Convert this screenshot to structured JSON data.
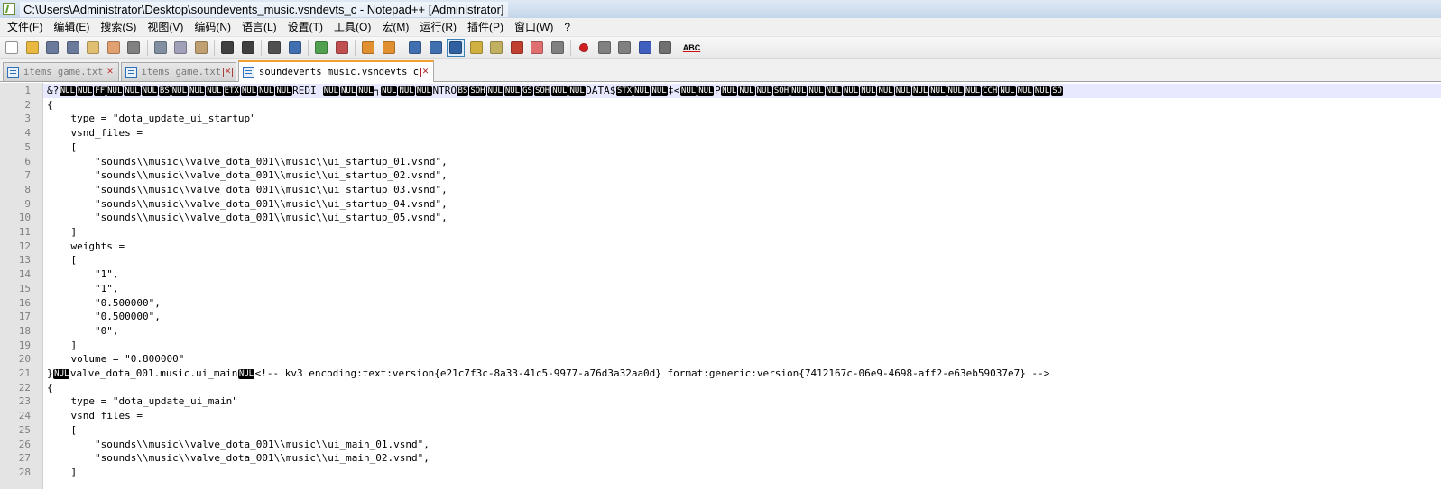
{
  "window": {
    "title": "C:\\Users\\Administrator\\Desktop\\soundevents_music.vsndevts_c - Notepad++ [Administrator]"
  },
  "menu": [
    "文件(F)",
    "编辑(E)",
    "搜索(S)",
    "视图(V)",
    "编码(N)",
    "语言(L)",
    "设置(T)",
    "工具(O)",
    "宏(M)",
    "运行(R)",
    "插件(P)",
    "窗口(W)",
    "?"
  ],
  "toolbar": {
    "spellcheck_label": "ABC",
    "buttons": [
      {
        "name": "new-file-icon",
        "color": "#ffffff"
      },
      {
        "name": "open-file-icon",
        "color": "#e8b840"
      },
      {
        "name": "save-icon",
        "color": "#6a7a9a"
      },
      {
        "name": "save-all-icon",
        "color": "#6a7a9a"
      },
      {
        "name": "close-icon",
        "color": "#e0c070"
      },
      {
        "name": "close-all-icon",
        "color": "#e0a070"
      },
      {
        "name": "print-icon",
        "color": "#808080"
      },
      {
        "name": "cut-icon",
        "color": "#8090a0"
      },
      {
        "name": "copy-icon",
        "color": "#a0a0b8"
      },
      {
        "name": "paste-icon",
        "color": "#c0a070"
      },
      {
        "name": "undo-icon",
        "color": "#404040"
      },
      {
        "name": "redo-icon",
        "color": "#404040"
      },
      {
        "name": "find-icon",
        "color": "#505050"
      },
      {
        "name": "replace-icon",
        "color": "#4070b0"
      },
      {
        "name": "zoom-in-icon",
        "color": "#50a050"
      },
      {
        "name": "zoom-out-icon",
        "color": "#c05050"
      },
      {
        "name": "sync-vertical-icon",
        "color": "#e09030"
      },
      {
        "name": "sync-horizontal-icon",
        "color": "#e09030"
      },
      {
        "name": "word-wrap-icon",
        "color": "#4070b0"
      },
      {
        "name": "show-all-chars-icon",
        "color": "#4070b0"
      },
      {
        "name": "indent-guide-icon",
        "color": "#3060a0"
      },
      {
        "name": "doc-map-icon",
        "color": "#d0b040"
      },
      {
        "name": "folder-workspace-icon",
        "color": "#c0b060"
      },
      {
        "name": "function-list-icon",
        "color": "#c04030"
      },
      {
        "name": "folder-as-workspace-icon",
        "color": "#e07070"
      },
      {
        "name": "monitoring-icon",
        "color": "#808080"
      },
      {
        "name": "record-macro-icon",
        "color": "#d02020"
      },
      {
        "name": "stop-macro-icon",
        "color": "#808080"
      },
      {
        "name": "play-macro-icon",
        "color": "#808080"
      },
      {
        "name": "run-macro-multiple-icon",
        "color": "#4060c0"
      },
      {
        "name": "save-macro-icon",
        "color": "#707070"
      }
    ]
  },
  "tabs": [
    {
      "label": "items_game.txt",
      "active": false
    },
    {
      "label": "items_game.txt",
      "active": false
    },
    {
      "label": "soundevents_music.vsndevts_c",
      "active": true
    }
  ],
  "editor": {
    "lines": [
      {
        "n": "1",
        "segs": [
          [
            "t",
            "&?"
          ],
          [
            "c",
            "NUL"
          ],
          [
            "c",
            "NUL"
          ],
          [
            "c",
            "FF"
          ],
          [
            "c",
            "NUL"
          ],
          [
            "c",
            "NUL"
          ],
          [
            "c",
            "NUL"
          ],
          [
            "c",
            "BS"
          ],
          [
            "c",
            "NUL"
          ],
          [
            "c",
            "NUL"
          ],
          [
            "c",
            "NUL"
          ],
          [
            "c",
            "ETX"
          ],
          [
            "c",
            "NUL"
          ],
          [
            "c",
            "NUL"
          ],
          [
            "c",
            "NUL"
          ],
          [
            "t",
            "REDI "
          ],
          [
            "c",
            "NUL"
          ],
          [
            "c",
            "NUL"
          ],
          [
            "c",
            "NUL"
          ],
          [
            "t",
            "┐"
          ],
          [
            "c",
            "NUL"
          ],
          [
            "c",
            "NUL"
          ],
          [
            "c",
            "NUL"
          ],
          [
            "t",
            "NTRO"
          ],
          [
            "c",
            "BS"
          ],
          [
            "c",
            "SOH"
          ],
          [
            "c",
            "NUL"
          ],
          [
            "c",
            "NUL"
          ],
          [
            "c",
            "GS"
          ],
          [
            "c",
            "SOH"
          ],
          [
            "c",
            "NUL"
          ],
          [
            "c",
            "NUL"
          ],
          [
            "t",
            "DATA$"
          ],
          [
            "c",
            "STX"
          ],
          [
            "c",
            "NUL"
          ],
          [
            "c",
            "NUL"
          ],
          [
            "t",
            "‡<"
          ],
          [
            "c",
            "NUL"
          ],
          [
            "c",
            "NUL"
          ],
          [
            "t",
            "P"
          ],
          [
            "c",
            "NUL"
          ],
          [
            "c",
            "NUL"
          ],
          [
            "c",
            "NUL"
          ],
          [
            "c",
            "SOH"
          ],
          [
            "c",
            "NUL"
          ],
          [
            "c",
            "NUL"
          ],
          [
            "c",
            "NUL"
          ],
          [
            "c",
            "NUL"
          ],
          [
            "c",
            "NUL"
          ],
          [
            "c",
            "NUL"
          ],
          [
            "c",
            "NUL"
          ],
          [
            "c",
            "NUL"
          ],
          [
            "c",
            "NUL"
          ],
          [
            "c",
            "NUL"
          ],
          [
            "c",
            "NUL"
          ],
          [
            "c",
            "CCH"
          ],
          [
            "c",
            "NUL"
          ],
          [
            "c",
            "NUL"
          ],
          [
            "c",
            "NUL"
          ],
          [
            "c",
            "SO"
          ]
        ]
      },
      {
        "n": "2",
        "segs": [
          [
            "t",
            "{"
          ]
        ]
      },
      {
        "n": "3",
        "segs": [
          [
            "t",
            "    type = \"dota_update_ui_startup\""
          ]
        ]
      },
      {
        "n": "4",
        "segs": [
          [
            "t",
            "    vsnd_files ="
          ]
        ]
      },
      {
        "n": "5",
        "segs": [
          [
            "t",
            "    ["
          ]
        ]
      },
      {
        "n": "6",
        "segs": [
          [
            "t",
            "        \"sounds\\\\music\\\\valve_dota_001\\\\music\\\\ui_startup_01.vsnd\","
          ]
        ]
      },
      {
        "n": "7",
        "segs": [
          [
            "t",
            "        \"sounds\\\\music\\\\valve_dota_001\\\\music\\\\ui_startup_02.vsnd\","
          ]
        ]
      },
      {
        "n": "8",
        "segs": [
          [
            "t",
            "        \"sounds\\\\music\\\\valve_dota_001\\\\music\\\\ui_startup_03.vsnd\","
          ]
        ]
      },
      {
        "n": "9",
        "segs": [
          [
            "t",
            "        \"sounds\\\\music\\\\valve_dota_001\\\\music\\\\ui_startup_04.vsnd\","
          ]
        ]
      },
      {
        "n": "10",
        "segs": [
          [
            "t",
            "        \"sounds\\\\music\\\\valve_dota_001\\\\music\\\\ui_startup_05.vsnd\","
          ]
        ]
      },
      {
        "n": "11",
        "segs": [
          [
            "t",
            "    ]"
          ]
        ]
      },
      {
        "n": "12",
        "segs": [
          [
            "t",
            "    weights ="
          ]
        ]
      },
      {
        "n": "13",
        "segs": [
          [
            "t",
            "    ["
          ]
        ]
      },
      {
        "n": "14",
        "segs": [
          [
            "t",
            "        \"1\","
          ]
        ]
      },
      {
        "n": "15",
        "segs": [
          [
            "t",
            "        \"1\","
          ]
        ]
      },
      {
        "n": "16",
        "segs": [
          [
            "t",
            "        \"0.500000\","
          ]
        ]
      },
      {
        "n": "17",
        "segs": [
          [
            "t",
            "        \"0.500000\","
          ]
        ]
      },
      {
        "n": "18",
        "segs": [
          [
            "t",
            "        \"0\","
          ]
        ]
      },
      {
        "n": "19",
        "segs": [
          [
            "t",
            "    ]"
          ]
        ]
      },
      {
        "n": "20",
        "segs": [
          [
            "t",
            "    volume = \"0.800000\""
          ]
        ]
      },
      {
        "n": "21",
        "segs": [
          [
            "t",
            "}"
          ],
          [
            "c",
            "NUL"
          ],
          [
            "t",
            "valve_dota_001.music.ui_main"
          ],
          [
            "c",
            "NUL"
          ],
          [
            "t",
            "<!-- kv3 encoding:text:version{e21c7f3c-8a33-41c5-9977-a76d3a32aa0d} format:generic:version{7412167c-06e9-4698-aff2-e63eb59037e7} -->"
          ]
        ]
      },
      {
        "n": "22",
        "segs": [
          [
            "t",
            "{"
          ]
        ]
      },
      {
        "n": "23",
        "segs": [
          [
            "t",
            "    type = \"dota_update_ui_main\""
          ]
        ]
      },
      {
        "n": "24",
        "segs": [
          [
            "t",
            "    vsnd_files ="
          ]
        ]
      },
      {
        "n": "25",
        "segs": [
          [
            "t",
            "    ["
          ]
        ]
      },
      {
        "n": "26",
        "segs": [
          [
            "t",
            "        \"sounds\\\\music\\\\valve_dota_001\\\\music\\\\ui_main_01.vsnd\","
          ]
        ]
      },
      {
        "n": "27",
        "segs": [
          [
            "t",
            "        \"sounds\\\\music\\\\valve_dota_001\\\\music\\\\ui_main_02.vsnd\","
          ]
        ]
      },
      {
        "n": "28",
        "segs": [
          [
            "t",
            "    ]"
          ]
        ]
      }
    ]
  }
}
